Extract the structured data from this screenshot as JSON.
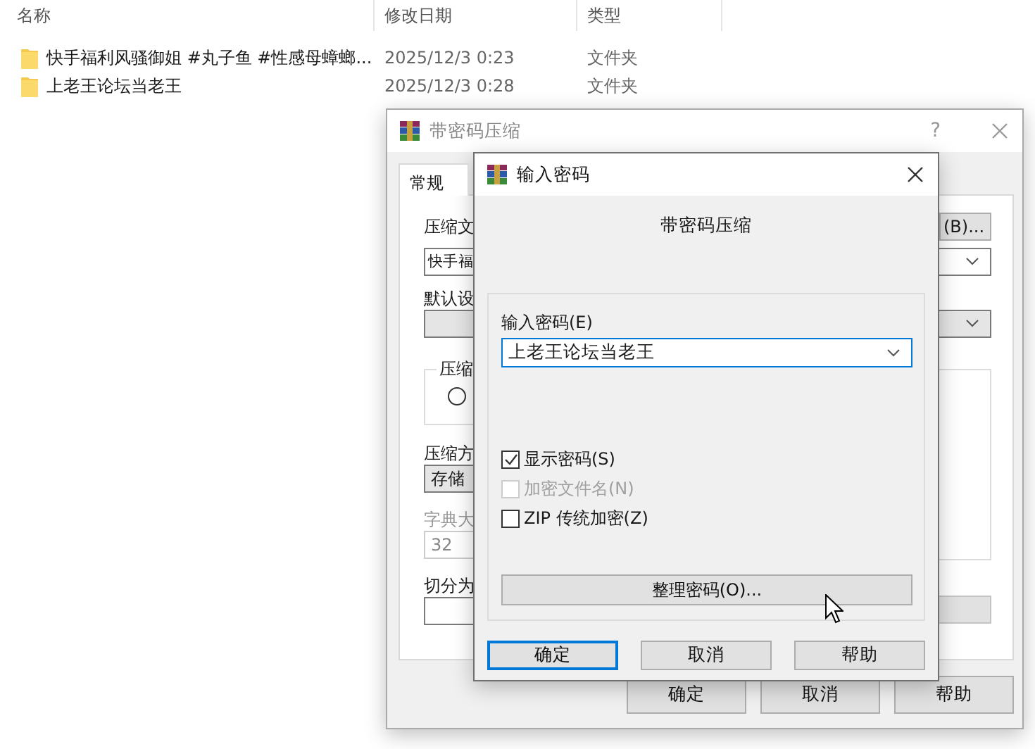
{
  "explorer": {
    "columns": [
      "名称",
      "修改日期",
      "类型"
    ],
    "rows": [
      {
        "name": "快手福利风骚御姐 #丸子鱼 #性感母蟑螂...",
        "modified": "2025/12/3 0:23",
        "type": "文件夹"
      },
      {
        "name": "上老王论坛当老王",
        "modified": "2025/12/3 0:28",
        "type": "文件夹"
      }
    ]
  },
  "back_dialog": {
    "title": "带密码压缩",
    "help": "?",
    "tabs": [
      {
        "label": "常规",
        "selected": true
      }
    ],
    "archive_label": "压缩文",
    "archive_name": "快手福",
    "browse_button": "(B)...",
    "profile_label": "默认设",
    "group_label": "压缩",
    "radio": {
      "selected": false
    },
    "method_label": "压缩方",
    "method": "存储",
    "dict_label": "字典大",
    "dict_value": "32",
    "dict_disabled": true,
    "split_label": "切分为",
    "buttons": [
      "确定",
      "取消",
      "帮助"
    ]
  },
  "password_dialog": {
    "title": "输入密码",
    "subtitle": "带密码压缩",
    "password_label": "输入密码(E)",
    "password": "上老王论坛当老王",
    "options": [
      {
        "label": "显示密码(S)",
        "checked": true,
        "disabled": false
      },
      {
        "label": "加密文件名(N)",
        "checked": false,
        "disabled": true
      },
      {
        "label": "ZIP 传统加密(Z)",
        "checked": false,
        "disabled": false
      }
    ],
    "manage_button": "整理密码(O)...",
    "buttons": [
      {
        "label": "确定",
        "default": true
      },
      {
        "label": "取消",
        "default": false
      },
      {
        "label": "帮助",
        "default": false
      }
    ]
  }
}
